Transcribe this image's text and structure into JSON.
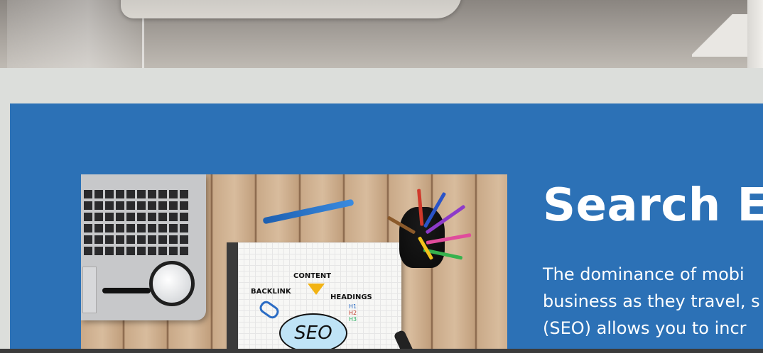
{
  "service": {
    "title": "Search E",
    "body_lines": [
      "The dominance of mobi",
      "business as they travel, s",
      "(SEO) allows you to incr"
    ]
  },
  "illustration": {
    "words": {
      "content": "CONTENT",
      "backlink": "BACKLINK",
      "headings": "HEADINGS",
      "seo": "SEO",
      "h_tags": [
        "H1",
        "H2",
        "H3"
      ]
    }
  },
  "colors": {
    "panel_background": "#2c71b6",
    "page_background": "#dcdedb",
    "heading_text": "#ffffff"
  }
}
